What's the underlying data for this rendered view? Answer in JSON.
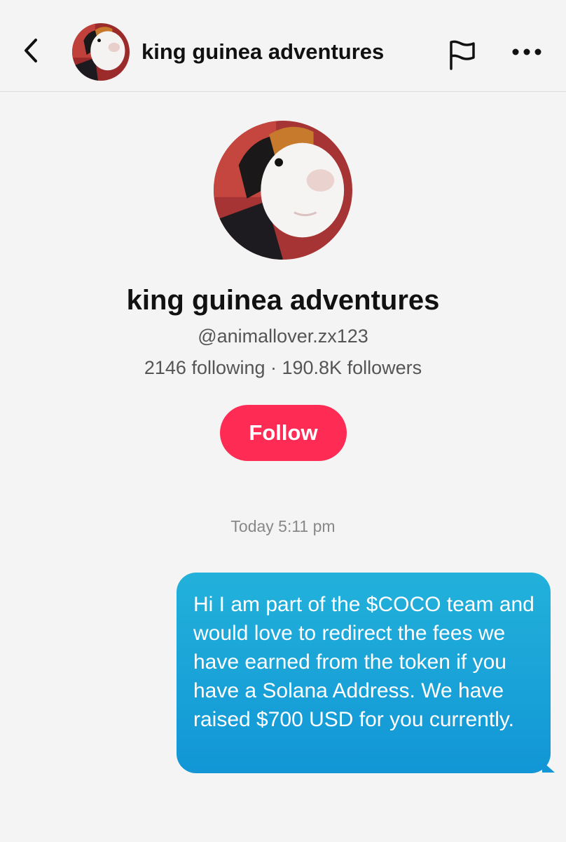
{
  "header": {
    "title": "king guinea adventures",
    "icons": [
      "back-chevron-icon",
      "flag-icon",
      "more-icon"
    ]
  },
  "profile": {
    "name": "king guinea adventures",
    "handle": "@animallover.zx123",
    "stats": "2146 following · 190.8K followers",
    "follow_label": "Follow",
    "accent_color": "#fe2c55"
  },
  "conversation": {
    "timestamp": "Today 5:11 pm",
    "messages": [
      {
        "text": "Hi I am part of the $COCO team and would love to redirect the fees we have earned from the token if you have a Solana Address. We have raised $700 USD for you currently."
      }
    ],
    "bubble_color": "#1296d6"
  }
}
